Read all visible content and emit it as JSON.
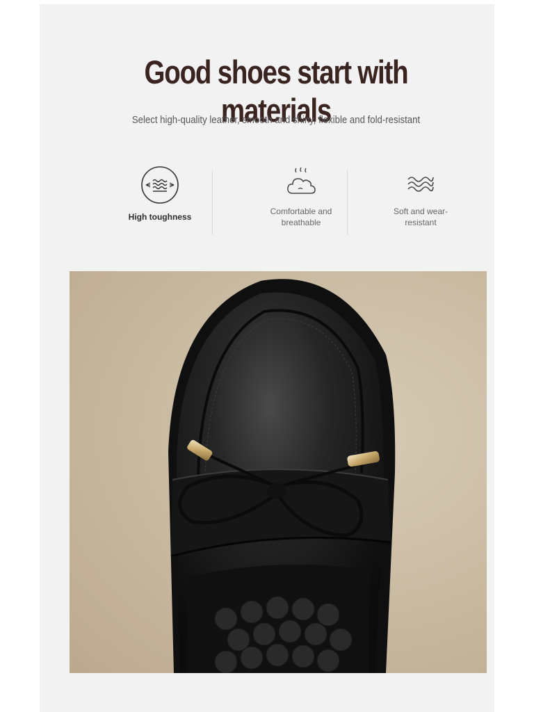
{
  "header": {
    "title": "Good shoes start with materials",
    "subtitle": "Select high-quality leather, smooth and shiny, flexible and fold-resistant"
  },
  "features": [
    {
      "icon": "fabric-stretch-icon",
      "label": "High toughness"
    },
    {
      "icon": "breathable-cloud-icon",
      "label_line1": "Comfortable and",
      "label_line2": "breathable"
    },
    {
      "icon": "soft-wave-icon",
      "label_line1": "Soft and wear-",
      "label_line2": "resistant"
    }
  ],
  "photo": {
    "subject": "black-leather-loafer-with-bow"
  },
  "colors": {
    "title": "#3a2420",
    "panel": "#f2f2f2",
    "leather": "#1a1a1a",
    "metal": "#c9b07a"
  }
}
